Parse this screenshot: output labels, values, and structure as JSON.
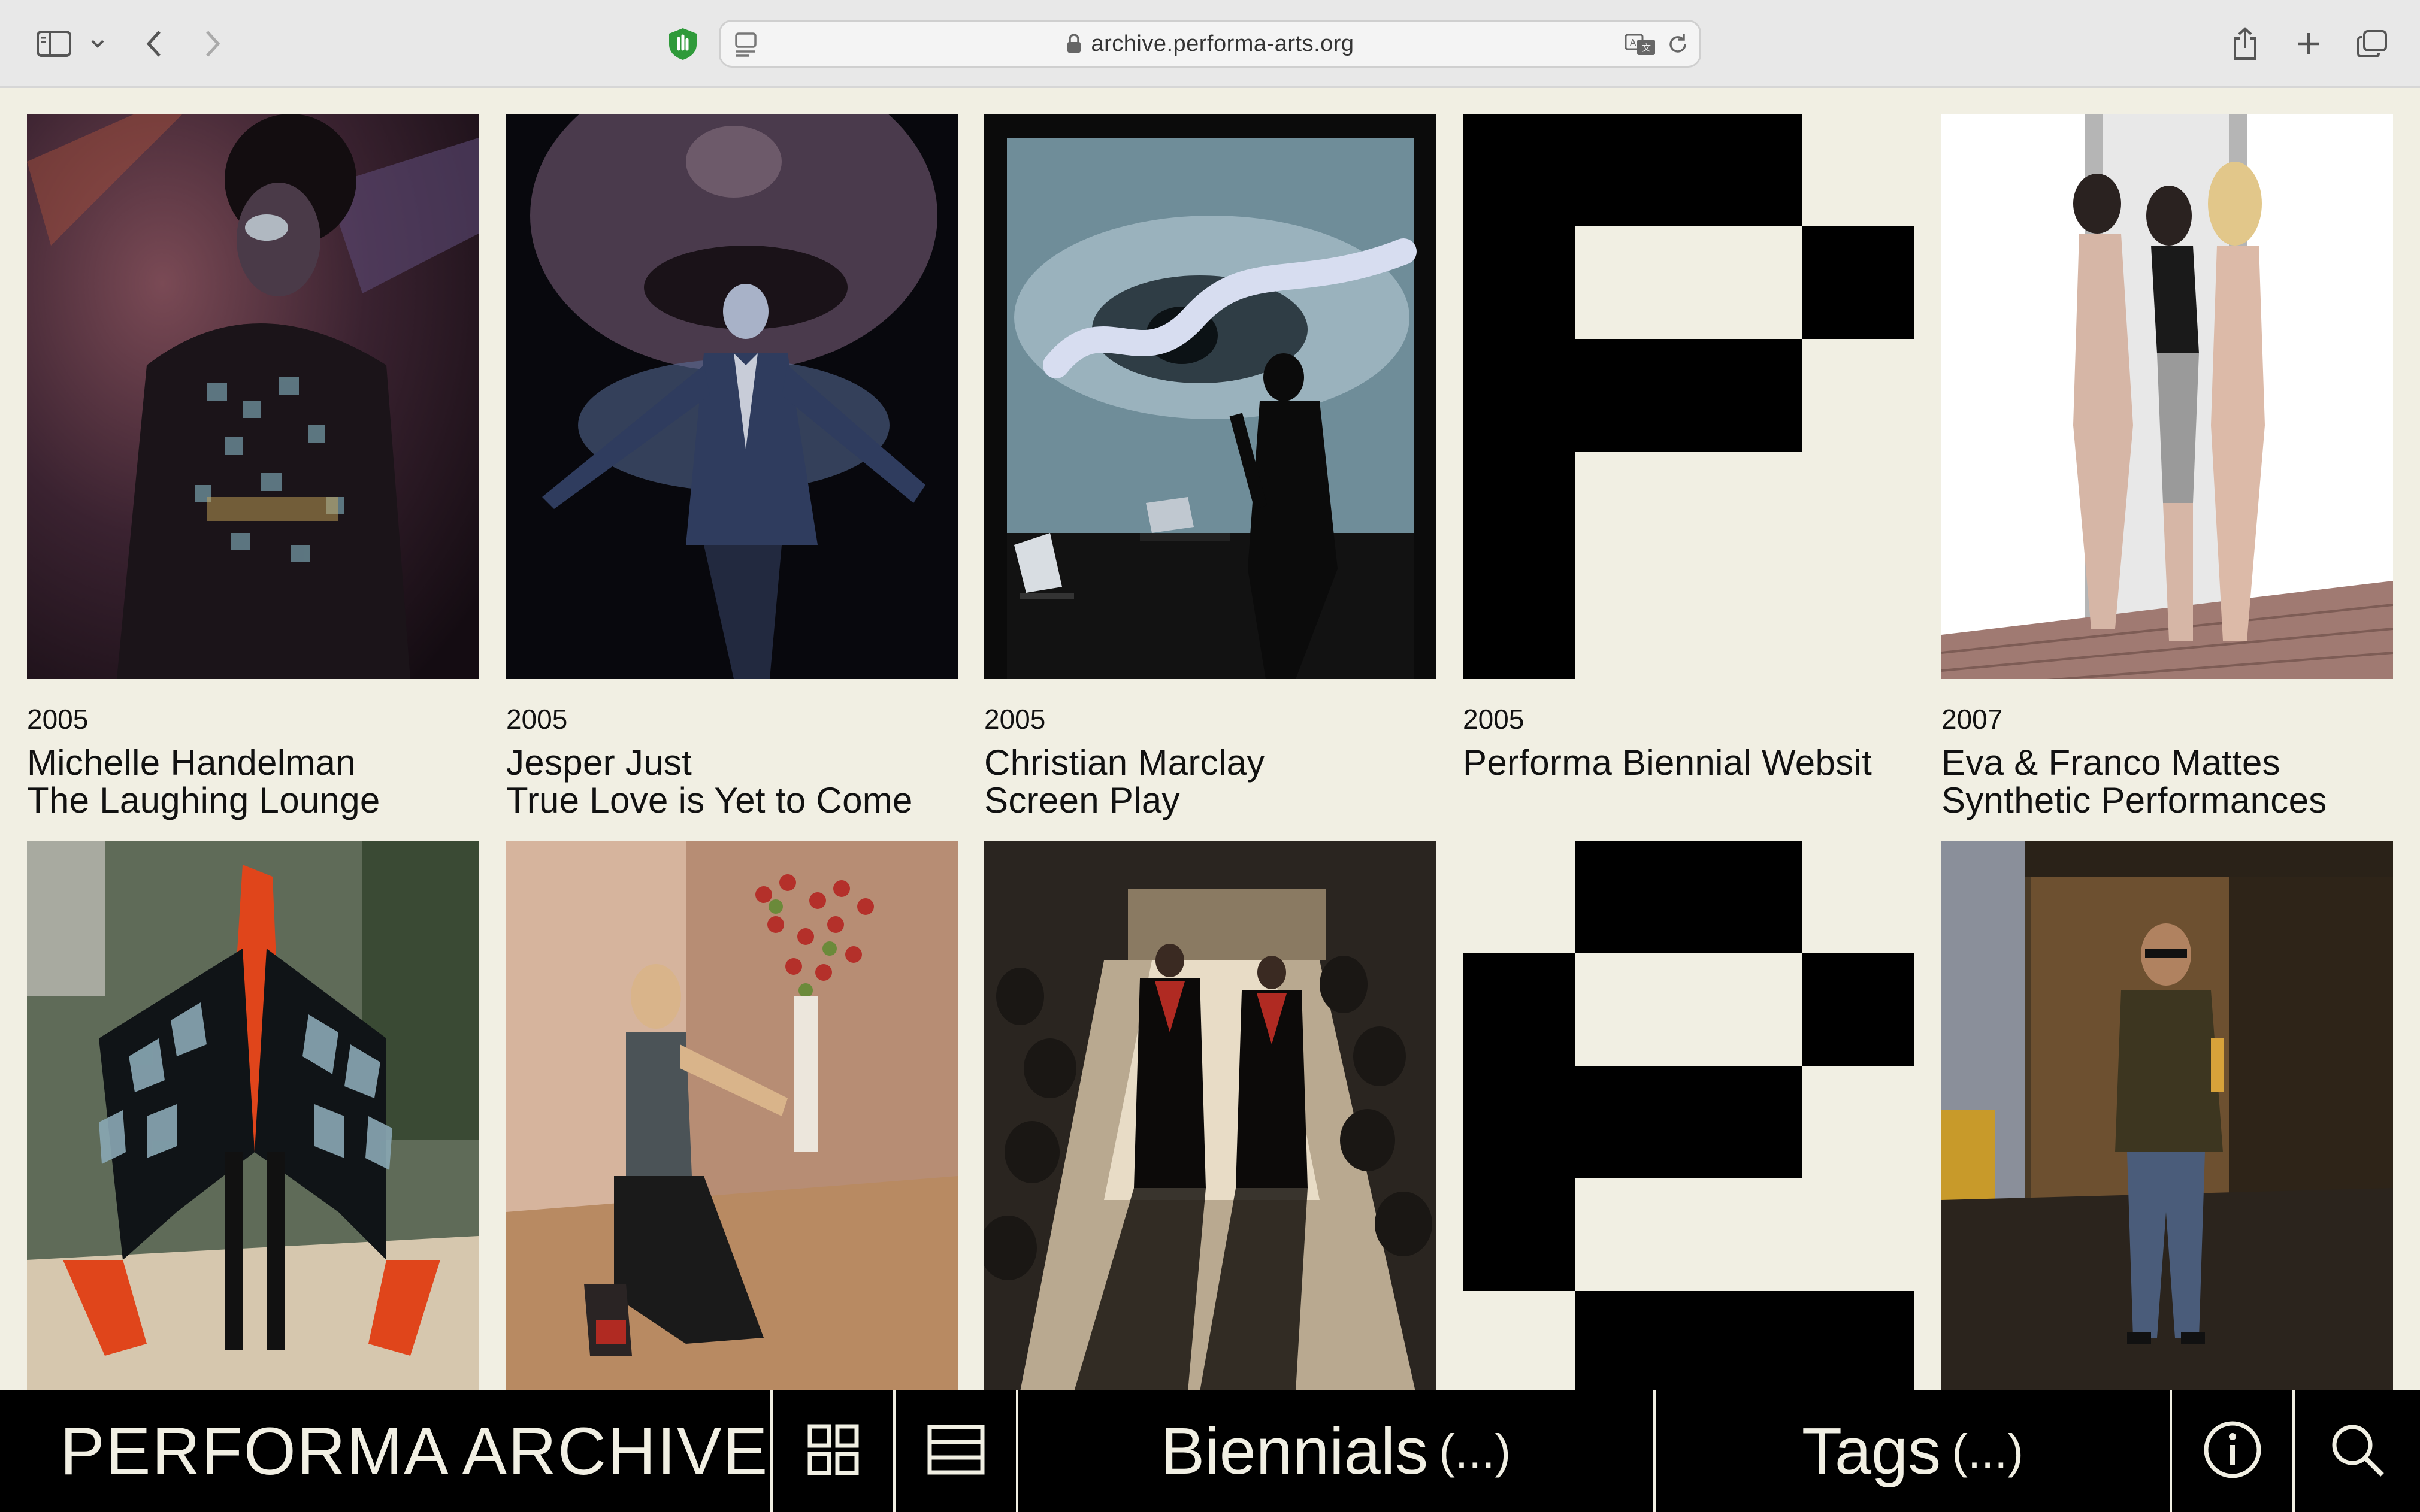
{
  "browser": {
    "url": "archive.performa-arts.org",
    "icons": [
      "sidebar-icon",
      "chevron-down-icon",
      "back-icon",
      "forward-icon",
      "shield-icon",
      "page-menu-icon",
      "lock-icon",
      "translate-icon",
      "reload-icon",
      "share-icon",
      "new-tab-icon",
      "tabs-overview-icon"
    ]
  },
  "cards": [
    {
      "year": "2005",
      "artist": "Michelle Handelman",
      "title": "The Laughing Lounge",
      "image": "performer with mirrored costume in red light"
    },
    {
      "year": "2005",
      "artist": "Jesper Just",
      "title": "True Love is Yet to Come",
      "image": "singer in suit with projected face"
    },
    {
      "year": "2005",
      "artist": "Christian Marclay",
      "title": "Screen Play",
      "image": "projected eye with musician silhouette"
    },
    {
      "year": "2005",
      "artist": "Performa Biennial Websit",
      "title": "",
      "image": "performa pixel logo"
    },
    {
      "year": "2007",
      "artist": "Eva & Franco Mattes",
      "title": "Synthetic Performances",
      "image": "three 3D avatar figures"
    },
    {
      "image": "performer in mirrored bird costume"
    },
    {
      "image": "kneeling dancer pointing"
    },
    {
      "image": "two robed figures walking between audience"
    },
    {
      "image": "performa pixel logo"
    },
    {
      "image": "man walking on stage"
    }
  ],
  "bottom_bar": {
    "brand": "PERFORMA ARCHIVE",
    "grid_view": "grid-view-icon",
    "list_view": "list-view-icon",
    "biennials": "Biennials",
    "biennials_count": "(...)",
    "tags": "Tags",
    "tags_count": "(...)",
    "info": "info-icon",
    "search": "search-icon"
  },
  "colors": {
    "background": "#f1efe3",
    "bar": "#000000",
    "text": "#111111"
  }
}
